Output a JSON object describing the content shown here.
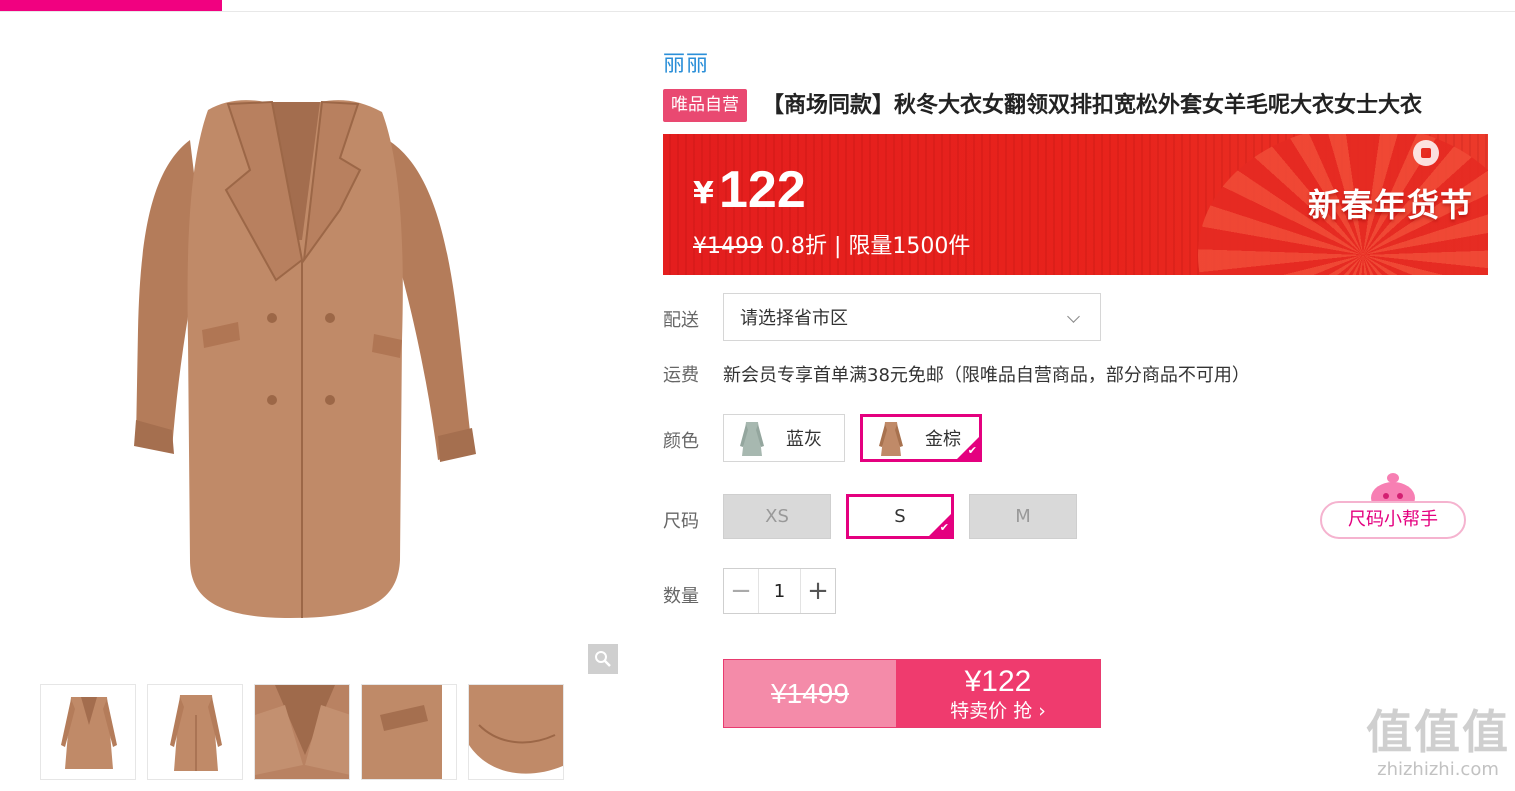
{
  "brand": "丽丽",
  "product": {
    "badge": "唯品自营",
    "title": "【商场同款】秋冬大衣女翻领双排扣宽松外套女羊毛呢大衣女士大衣"
  },
  "price_banner": {
    "currency": "¥",
    "price": "122",
    "original_price": "¥1499",
    "discount_info": " 0.8折 | 限量1500件",
    "festival": "新春年货节"
  },
  "delivery": {
    "label": "配送",
    "placeholder": "请选择省市区"
  },
  "shipping": {
    "label": "运费",
    "text": "新会员专享首单满38元免邮（限唯品自营商品，部分商品不可用）"
  },
  "color": {
    "label": "颜色",
    "options": [
      {
        "name": "蓝灰",
        "selected": false,
        "swatch": "#a7b8b0"
      },
      {
        "name": "金棕",
        "selected": true,
        "swatch": "#c08a68"
      }
    ]
  },
  "size": {
    "label": "尺码",
    "options": [
      {
        "name": "XS",
        "available": false
      },
      {
        "name": "S",
        "available": true,
        "selected": true
      },
      {
        "name": "M",
        "available": false
      }
    ],
    "helper": "尺码小帮手"
  },
  "quantity": {
    "label": "数量",
    "value": "1",
    "minus": "−",
    "plus": "+"
  },
  "buy": {
    "original": "¥1499",
    "price": "¥122",
    "action": "特卖价 抢 ›"
  },
  "watermark": {
    "logo": "值值值",
    "url": "zhizhizhi.com"
  },
  "colors": {
    "accent": "#f10180",
    "banner_red": "#e41e1e",
    "coat": "#c08a68",
    "buy_pink": "#ef3b6e"
  }
}
